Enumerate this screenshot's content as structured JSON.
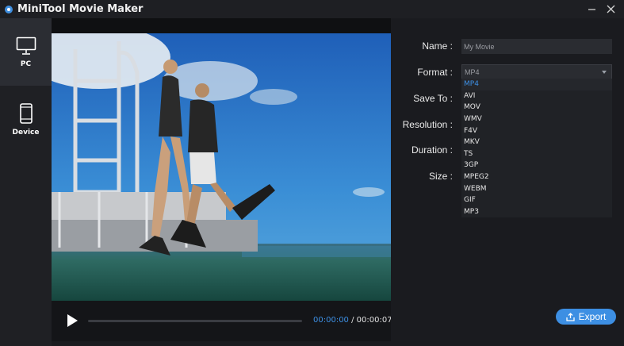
{
  "window": {
    "title": "MiniTool Movie Maker"
  },
  "sidebar": {
    "items": [
      {
        "label": "PC",
        "icon": "monitor-icon",
        "active": true
      },
      {
        "label": "Device",
        "icon": "phone-icon",
        "active": false
      }
    ]
  },
  "player": {
    "current_time": "00:00:00",
    "separator": "/",
    "total_time": "00:00:07",
    "progress": 0
  },
  "settings": {
    "name_label": "Name :",
    "name_value": "My Movie",
    "format_label": "Format :",
    "format_value": "MP4",
    "save_to_label": "Save To :",
    "resolution_label": "Resolution :",
    "duration_label": "Duration :",
    "size_label": "Size :"
  },
  "format_options": [
    "MP4",
    "AVI",
    "MOV",
    "WMV",
    "F4V",
    "MKV",
    "TS",
    "3GP",
    "MPEG2",
    "WEBM",
    "GIF",
    "MP3"
  ],
  "export": {
    "label": "Export"
  },
  "colors": {
    "accent": "#3d8fe3",
    "background": "#1a1b1f"
  }
}
